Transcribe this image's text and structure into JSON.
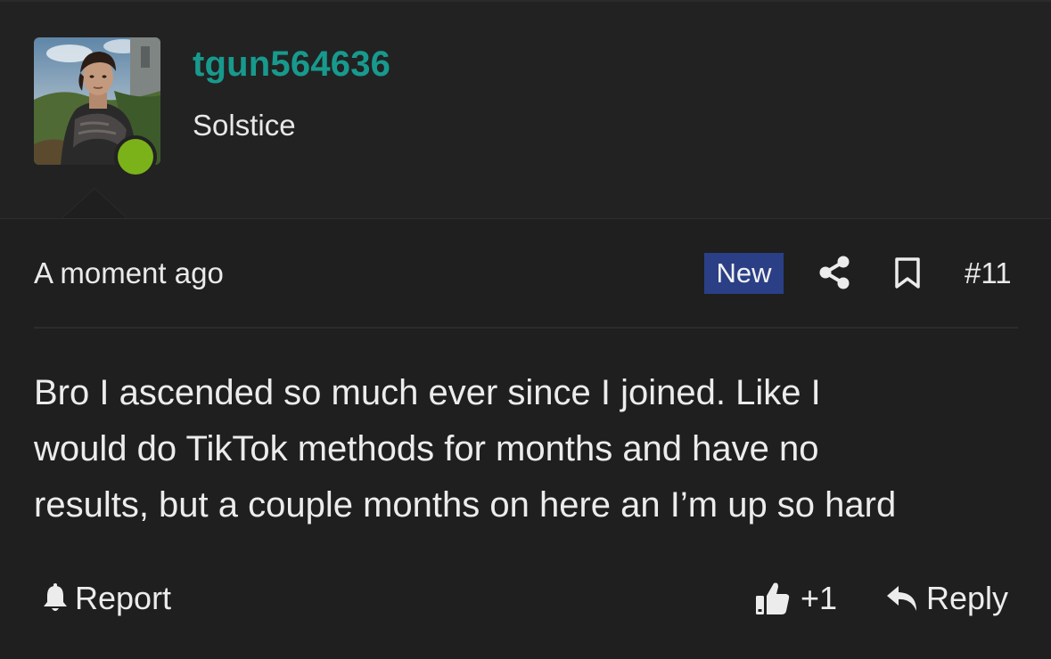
{
  "post": {
    "author": {
      "username": "tgun564636",
      "user_title": "Solstice",
      "online": true,
      "username_color": "#179a8d",
      "online_color": "#7bb21a"
    },
    "meta": {
      "time": "A moment ago",
      "badge": "New",
      "badge_color": "#2b3f86",
      "number": "#11"
    },
    "body_lines": [
      "Bro I ascended so much ever since I joined. Like I",
      "would do TikTok methods for months and have no",
      "results, but a couple months on here an I’m up so hard"
    ],
    "actions": {
      "report_label": "Report",
      "like_count": "+1",
      "reply_label": "Reply"
    },
    "icons": [
      "share-icon",
      "bookmark-icon",
      "bell-icon",
      "thumbs-up-icon",
      "reply-arrow-icon"
    ]
  }
}
